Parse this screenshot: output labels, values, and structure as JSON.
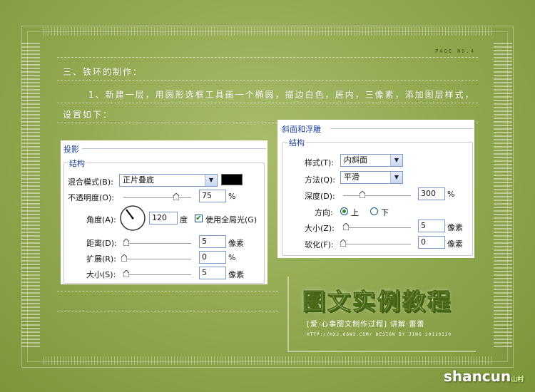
{
  "page": {
    "page_no": "PAGE NO.4",
    "heading": "三、铁环的制作：",
    "paragraph_line1": "1、新建一层，用圆形选框工具画一个椭圆，描边白色，居内，三像素，添加图层样式，",
    "paragraph_line2": "设置如下："
  },
  "drop_shadow": {
    "title": "投影",
    "group": "结构",
    "blend_mode_label": "混合模式(B):",
    "blend_mode_value": "正片叠底",
    "opacity_label": "不透明度(O):",
    "opacity_value": "75",
    "opacity_unit": "%",
    "angle_label": "角度(A):",
    "angle_value": "120",
    "angle_unit": "度",
    "global_light_label": "使用全局光(G)",
    "global_light_checked": true,
    "distance_label": "距离(D):",
    "distance_value": "5",
    "distance_unit": "像素",
    "spread_label": "扩展(R):",
    "spread_value": "0",
    "spread_unit": "%",
    "size_label": "大小(S):",
    "size_value": "5",
    "size_unit": "像素",
    "shadow_color": "#000000"
  },
  "bevel": {
    "title": "斜面和浮雕",
    "group": "结构",
    "style_label": "样式(T):",
    "style_value": "内斜面",
    "technique_label": "方法(Q):",
    "technique_value": "平滑",
    "depth_label": "深度(D):",
    "depth_value": "300",
    "depth_unit": "%",
    "direction_label": "方向:",
    "direction_up": "上",
    "direction_down": "下",
    "direction_selected": "上",
    "size_label": "大小(Z):",
    "size_value": "5",
    "size_unit": "像素",
    "soften_label": "软化(F):",
    "soften_value": "0",
    "soften_unit": "像素"
  },
  "logo": {
    "title": "图文实例教程",
    "subtitle": "[爱·心事图文制作过程]  讲解·蕾蕾",
    "url_line": "HTTP://HXJ.86W2.COM/  DESIGN BY JING  20110120"
  },
  "watermark": {
    "text": "shancun",
    "cn": "山村"
  },
  "colors": {
    "accent_blue": "#1a3f9a",
    "background_green": "#93aa52"
  }
}
